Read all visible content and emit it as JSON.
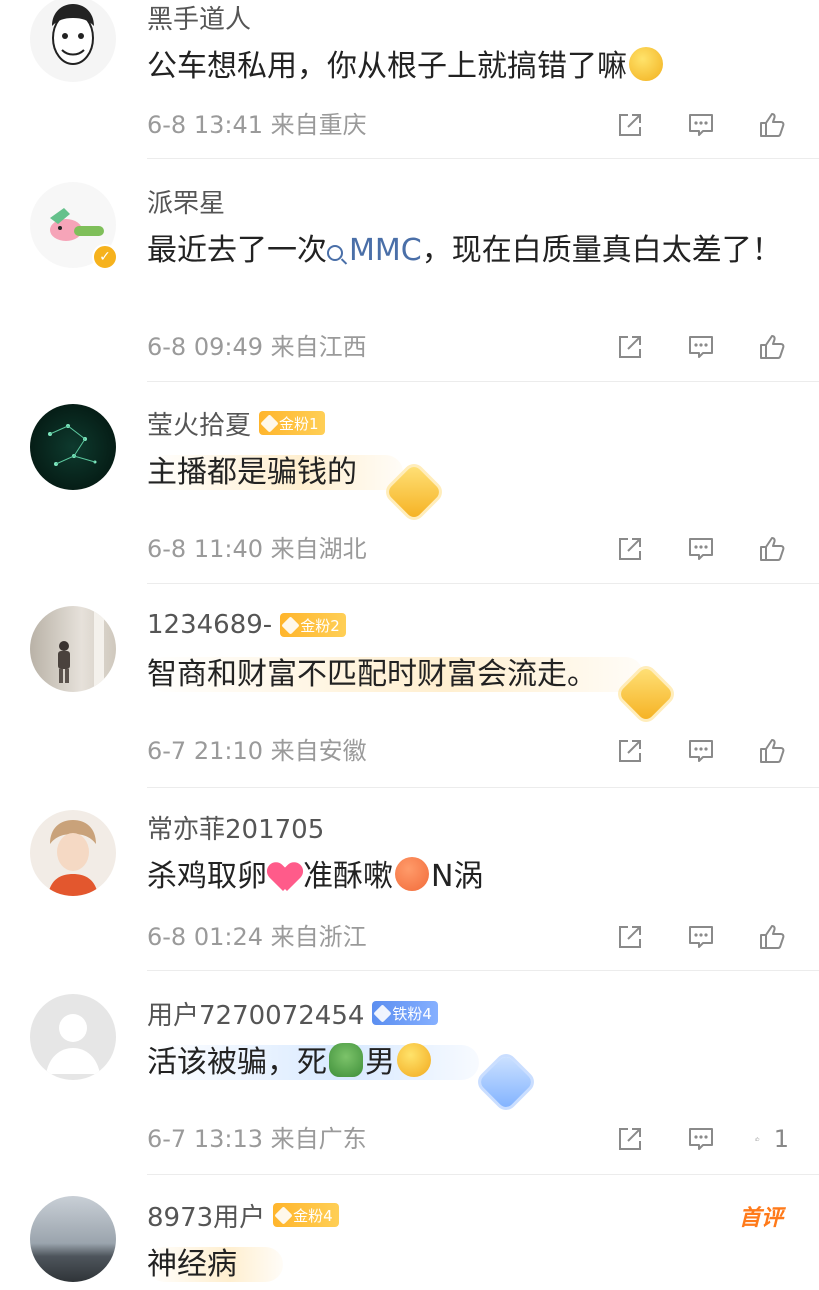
{
  "comments": [
    {
      "name": "黑手道人",
      "text": "公车想私用，你从根子上就搞错了嘛",
      "time": "6-8 13:41",
      "location": "来自重庆",
      "like_count": ""
    },
    {
      "name": "派罘星",
      "text_before": "最近去了一次",
      "link": "MMC",
      "text_after": "，现在白质量真白太差了！",
      "time": "6-8 09:49",
      "location": "来自江西",
      "like_count": ""
    },
    {
      "name": "莹火拾夏",
      "badge": "金粉1",
      "text": "主播都是骗钱的",
      "time": "6-8 11:40",
      "location": "来自湖北",
      "like_count": ""
    },
    {
      "name": "1234689-",
      "badge": "金粉2",
      "text": "智商和财富不匹配时财富会流走。",
      "time": "6-7 21:10",
      "location": "来自安徽",
      "like_count": ""
    },
    {
      "name": "常亦菲201705",
      "text_a": "杀鸡取卵",
      "text_b": "准酥嗽",
      "text_c": "N涡",
      "time": "6-8 01:24",
      "location": "来自浙江",
      "like_count": ""
    },
    {
      "name": "用户7270072454",
      "badge": "铁粉4",
      "text_a": "活该被骗，死",
      "text_b": "男",
      "time": "6-7 13:13",
      "location": "来自广东",
      "like_count": "1"
    },
    {
      "name": "8973用户",
      "badge": "金粉4",
      "text": "神经病",
      "first_tag": "首评"
    }
  ],
  "icons": {
    "share": "share-icon",
    "comment": "comment-icon",
    "like": "thumbs-up-icon"
  },
  "colors": {
    "gold_badge": "#ffb52c",
    "iron_badge": "#5b8ef0",
    "link": "#4a6fa8",
    "first_tag": "#ff7a1a"
  }
}
